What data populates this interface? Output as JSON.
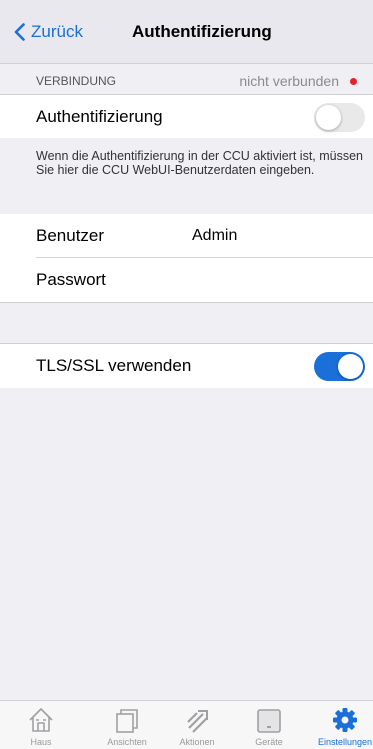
{
  "nav": {
    "back_label": "Zurück",
    "title": "Authentifizierung"
  },
  "section": {
    "header": "VERBINDUNG",
    "status": "nicht verbunden",
    "status_color": "#e8202c"
  },
  "auth_row": {
    "label": "Authentifizierung",
    "enabled": false
  },
  "info_text": "Wenn die Authentifizierung in der CCU aktiviert ist, müssen Sie hier die CCU WebUI-Benutzerdaten eingeben.",
  "credentials": {
    "user_label": "Benutzer",
    "user_value": "Admin",
    "password_label": "Passwort",
    "password_value": ""
  },
  "tls_row": {
    "label": "TLS/SSL verwenden",
    "enabled": true
  },
  "accent_color": "#1a6fd8",
  "tabs": [
    {
      "label": "Haus",
      "icon": "house-icon"
    },
    {
      "label": "Ansichten",
      "icon": "pages-icon"
    },
    {
      "label": "Aktionen",
      "icon": "actions-icon"
    },
    {
      "label": "Geräte",
      "icon": "device-icon"
    },
    {
      "label": "Einstellungen",
      "icon": "gear-icon",
      "active": true
    }
  ]
}
